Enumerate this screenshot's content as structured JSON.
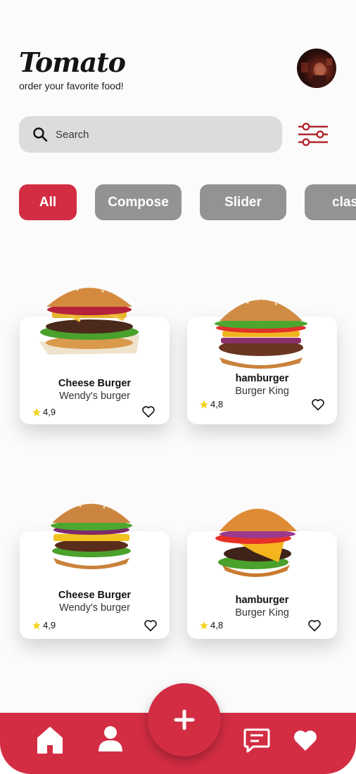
{
  "app": {
    "title": "Tomato",
    "tagline": "order your favorite food!"
  },
  "search": {
    "placeholder": "Search"
  },
  "categories": [
    {
      "label": "All",
      "active": true
    },
    {
      "label": "Compose",
      "active": false
    },
    {
      "label": "Slider",
      "active": false
    },
    {
      "label": "clas",
      "active": false
    }
  ],
  "products": [
    {
      "name": "Cheese Burger",
      "brand": "Wendy's burger",
      "rating": "4,9"
    },
    {
      "name": "hamburger",
      "brand": "Burger King",
      "rating": "4,8"
    },
    {
      "name": "Cheese Burger",
      "brand": "Wendy's burger",
      "rating": "4,9"
    },
    {
      "name": "hamburger",
      "brand": "Burger King",
      "rating": "4,8"
    }
  ],
  "nav": {
    "items": [
      "home-icon",
      "profile-icon",
      "add-icon",
      "chat-icon",
      "heart-icon"
    ]
  },
  "colors": {
    "accent": "#d32d43",
    "chip_inactive": "#939294",
    "search_bg": "#dcdbde",
    "star": "#f2d21b"
  }
}
